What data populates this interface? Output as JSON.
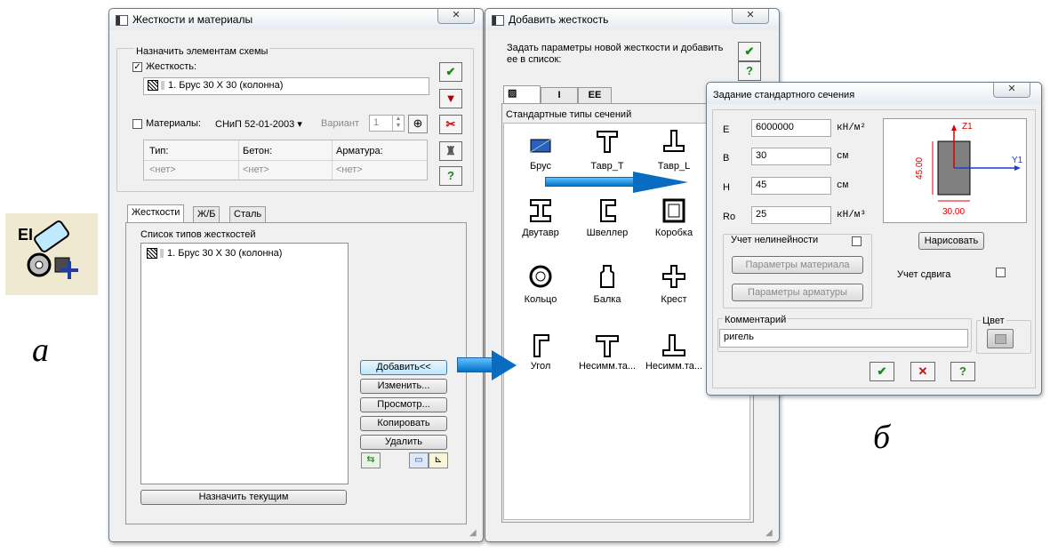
{
  "letters": {
    "a": "а",
    "b": "б"
  },
  "win1": {
    "title": "Жесткости и материалы",
    "assign_group": "Назначить элементам схемы",
    "stiffness_cb": "Жесткость:",
    "stiffness_value": "1. Брус 30 X 30 (колонна)",
    "materials_cb": "Материалы:",
    "materials_norm": "СНиП 52-01-2003 ▾",
    "variant_label": "Вариант",
    "variant_value": "1",
    "headers": [
      "Тип:",
      "Бетон:",
      "Арматура:"
    ],
    "values": [
      "<нет>",
      "<нет>",
      "<нет>"
    ],
    "tabs": [
      "Жесткости",
      "Ж/Б",
      "Сталь"
    ],
    "list_title": "Список типов жесткостей",
    "list_items": [
      "1. Брус 30 X 30 (колонна)"
    ],
    "buttons": [
      "Добавить<<",
      "Изменить...",
      "Просмотр...",
      "Копировать",
      "Удалить"
    ],
    "assign_current": "Назначить текущим",
    "help_glyph": "?"
  },
  "win2": {
    "title": "Добавить жесткость",
    "prompt": "Задать параметры новой жесткости и добавить ее в список:",
    "help_glyph": "?",
    "tabs": [
      "▨",
      "I",
      "EE"
    ],
    "types_title": "Стандартные типы сечений",
    "sections": [
      "Брус",
      "Тавр_Т",
      "Тавр_L",
      "Двутавр",
      "Швеллер",
      "Коробка",
      "Кольцо",
      "Балка",
      "Крест",
      "Угол",
      "Несимм.та...",
      "Несимм.та..."
    ]
  },
  "win3": {
    "title": "Задание стандартного сечения",
    "params": [
      {
        "label": "E",
        "value": "6000000",
        "unit": "кН/м²"
      },
      {
        "label": "B",
        "value": "30",
        "unit": "см"
      },
      {
        "label": "H",
        "value": "45",
        "unit": "см"
      },
      {
        "label": "Ro",
        "value": "25",
        "unit": "кН/м³"
      }
    ],
    "preview": {
      "z": "Z1",
      "y": "Y1",
      "h": "45.00",
      "w": "30.00"
    },
    "draw_btn": "Нарисовать",
    "nonlinear": "Учет нелинейности",
    "mat_params": "Параметры материала",
    "rebar_params": "Параметры арматуры",
    "shear": "Учет сдвига",
    "comment_label": "Комментарий",
    "comment_value": "ригель",
    "color_label": "Цвет",
    "help_glyph": "?"
  },
  "colors": {
    "arrow": "#0073c6",
    "ok": "#1a8a1a",
    "cancel": "#c01010"
  },
  "icons": [
    "stiffness-app-icon",
    "ok-check-icon",
    "filter-icon",
    "scissors-icon",
    "brush-icon",
    "help-icon"
  ]
}
